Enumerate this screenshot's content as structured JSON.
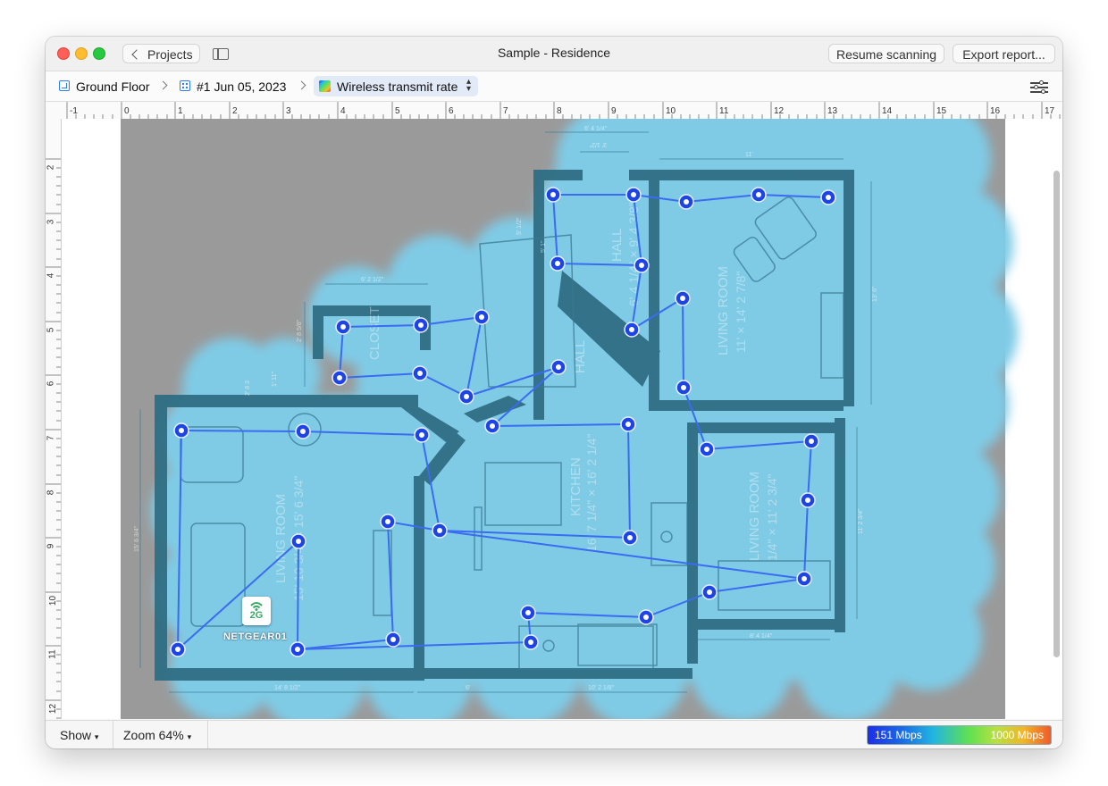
{
  "window": {
    "title": "Sample - Residence",
    "back_label": "Projects",
    "resume_label": "Resume scanning",
    "export_label": "Export report..."
  },
  "pathbar": {
    "floor": "Ground Floor",
    "scan": "#1 Jun 05, 2023",
    "metric": "Wireless transmit rate"
  },
  "ruler": {
    "top": [
      "-1",
      "0",
      "1",
      "2",
      "3",
      "4",
      "5",
      "6",
      "7",
      "8",
      "9",
      "10",
      "11",
      "12",
      "13",
      "14",
      "15",
      "16",
      "17"
    ],
    "left": [
      "2",
      "3",
      "4",
      "5",
      "6",
      "7",
      "8",
      "9",
      "10",
      "11",
      "12"
    ]
  },
  "plan": {
    "rooms": {
      "closet": "CLOSET",
      "hall_main": "HALL",
      "hall_2": "HALL",
      "living_room_left": "LIVING ROOM",
      "living_room_left_dims": "15' 10 3/4\" × 15' 6 3/4\"",
      "kitchen": "KITCHEN",
      "kitchen_dims": "16' 7 1/4\" × 16' 2 1/4\"",
      "living_room_right": "LIVING ROOM",
      "living_room_right_dims": "11' × 14' 2 7/8\"",
      "living_room_lower_right": "LIVING ROOM",
      "living_room_lower_right_dims": "1/4\" × 11' 2 3/4\"",
      "hall_dims": "6' 4 1/4\" × 9' 4 3/8\""
    },
    "dimensions": {
      "top_hall": "6' 4 1/4\"",
      "top_right": "11'",
      "closet_top": "6' 2 1/2\"",
      "closet_side": "2' 8 5/8\"",
      "entry_a": "2' 8 3",
      "entry_b": "1' 11\"",
      "stairs": "5' 1/2\"",
      "stairs_b": "5' 1\"",
      "hall_door": "3' 1/2\"",
      "left_wall": "15' 6 3/4\"",
      "bottom_left": "14' 8 1/2\"",
      "bottom_mid_a": "6'",
      "bottom_mid_b": "10' 2 1/8\"",
      "right_lower": "8' 4 1/4\"",
      "right_side": "11' 2 3/4\"",
      "right_top_side": "13' 6\""
    },
    "access_point": {
      "name": "NETGEAR01",
      "band": "2G"
    }
  },
  "footer": {
    "show_label": "Show",
    "zoom_label": "Zoom 64%",
    "legend_min": "151 Mbps",
    "legend_max": "1000 Mbps"
  },
  "colors": {
    "coverage": "#7fcbe6",
    "wall": "#2f6e84",
    "outside": "#9a9a9a",
    "path": "#3a6bf0",
    "point": "#1e44e8"
  }
}
